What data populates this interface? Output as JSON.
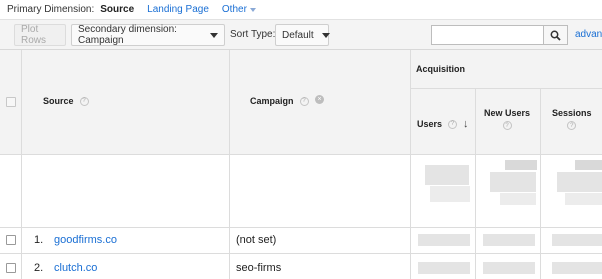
{
  "primary_dimension": {
    "label": "Primary Dimension:",
    "options": [
      "Source",
      "Landing Page"
    ],
    "active": "Source",
    "other_label": "Other"
  },
  "toolbar": {
    "plot_rows_label": "Plot Rows",
    "secondary_dimension_label": "Secondary dimension: Campaign",
    "sort_type_label": "Sort Type:",
    "sort_type_value": "Default",
    "search_placeholder": "",
    "advanced_label": "advanced"
  },
  "table": {
    "columns": {
      "source": "Source",
      "campaign": "Campaign",
      "group": "Acquisition",
      "users": "Users",
      "new_users": "New Users",
      "sessions": "Sessions"
    },
    "sort_indicator": "↓",
    "rows": [
      {
        "index": "1.",
        "source": "goodfirms.co",
        "campaign": "(not set)"
      },
      {
        "index": "2.",
        "source": "clutch.co",
        "campaign": "seo-firms"
      }
    ]
  }
}
